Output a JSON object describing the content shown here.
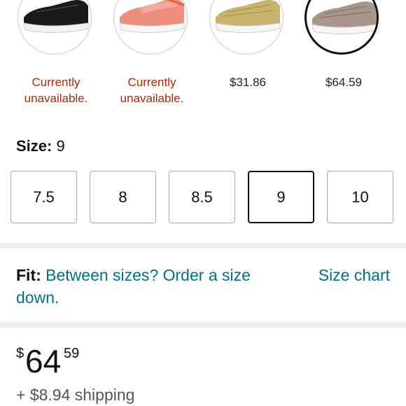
{
  "swatches": [
    {
      "price_text": "Currently\nunavailable.",
      "available": false,
      "selected": false,
      "color_name": "black-sequin"
    },
    {
      "price_text": "Currently\nunavailable.",
      "available": false,
      "selected": false,
      "color_name": "coral-woven"
    },
    {
      "price_text": "$31.86",
      "available": true,
      "selected": false,
      "color_name": "gold-woven"
    },
    {
      "price_text": "$64.59",
      "available": true,
      "selected": true,
      "color_name": "taupe-woven"
    }
  ],
  "size": {
    "label": "Size:",
    "value": "9",
    "options": [
      "7.5",
      "8",
      "8.5",
      "9",
      "10"
    ],
    "selected": "9"
  },
  "fit": {
    "label": "Fit:",
    "link_text": "Between sizes? Order a size down.",
    "size_chart": "Size chart"
  },
  "price": {
    "symbol": "$",
    "whole": "64",
    "fraction": "59"
  },
  "shipping": "+ $8.94 shipping",
  "colors": {
    "link": "#007185",
    "unavailable": "#b12704",
    "divider": "#eeeeee"
  }
}
